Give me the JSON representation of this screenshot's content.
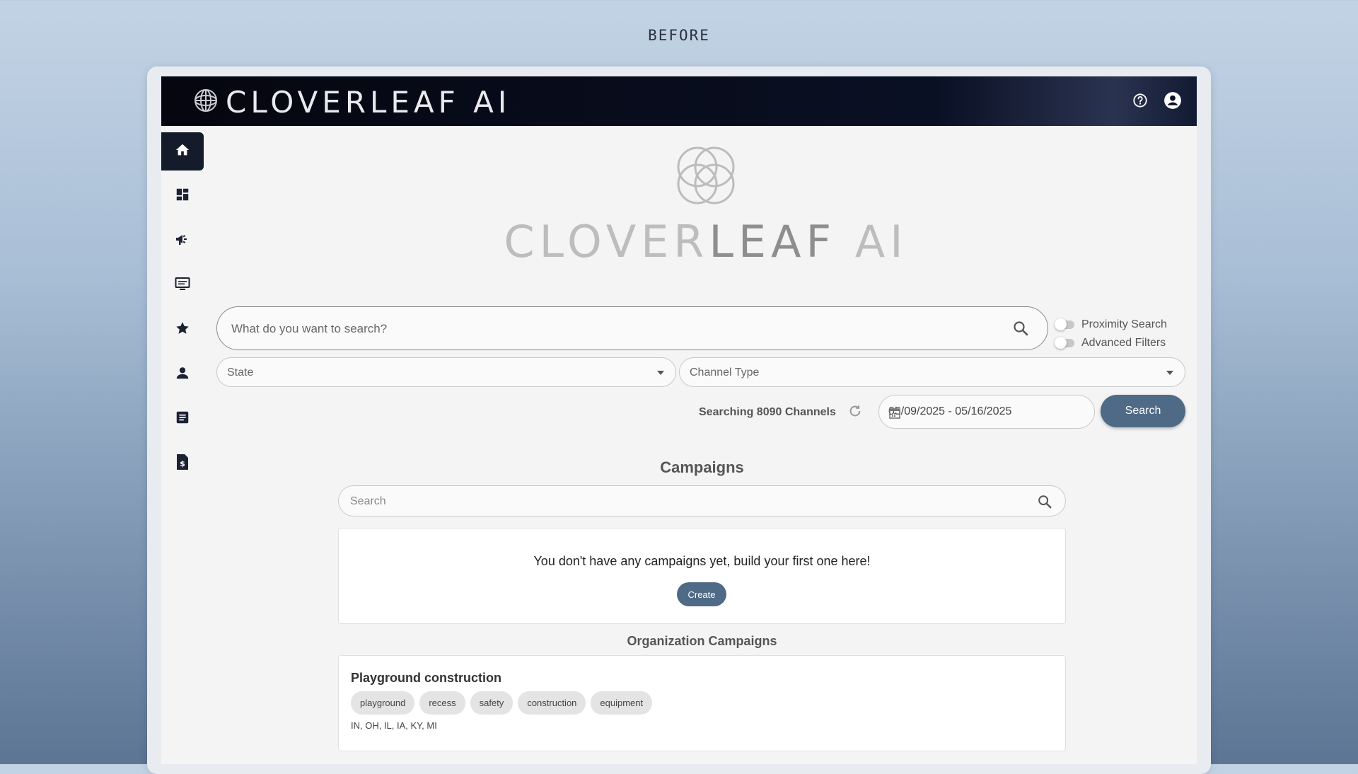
{
  "caption": "BEFORE",
  "brand": {
    "name": "CLOVERLEAF AI",
    "logo_icon": "globe-icon"
  },
  "header": {
    "icons": [
      "help-icon",
      "account-icon"
    ]
  },
  "sidebar": {
    "items": [
      {
        "icon": "home-icon",
        "active": true
      },
      {
        "icon": "dashboard-icon"
      },
      {
        "icon": "campaign-icon"
      },
      {
        "icon": "channels-icon"
      },
      {
        "icon": "star-icon"
      },
      {
        "icon": "person-icon"
      },
      {
        "icon": "article-icon"
      },
      {
        "icon": "invoice-icon"
      }
    ]
  },
  "hero": {
    "text_light": "CLOVER",
    "text_dark": "LEAF",
    "text_end": " AI"
  },
  "search": {
    "placeholder": "What do you want to search?",
    "proximity_label": "Proximity Search",
    "advanced_label": "Advanced Filters"
  },
  "filters": {
    "state_placeholder": "State",
    "channel_type_placeholder": "Channel Type"
  },
  "status": {
    "searching_text": "Searching 8090 Channels"
  },
  "date_range": "05/09/2025 - 05/16/2025",
  "search_button": "Search",
  "campaigns": {
    "title": "Campaigns",
    "search_placeholder": "Search",
    "empty_message": "You don't have any campaigns yet, build your first one here!",
    "create_label": "Create"
  },
  "org_campaigns": {
    "title": "Organization Campaigns",
    "items": [
      {
        "name": "Playground construction",
        "tags": [
          "playground",
          "recess",
          "safety",
          "construction",
          "equipment"
        ],
        "states": "IN, OH, IL, IA, KY, MI"
      }
    ]
  },
  "colors": {
    "accent": "#4f6a86",
    "topbar": "#05060f",
    "sidebar_active": "#141b2b"
  }
}
